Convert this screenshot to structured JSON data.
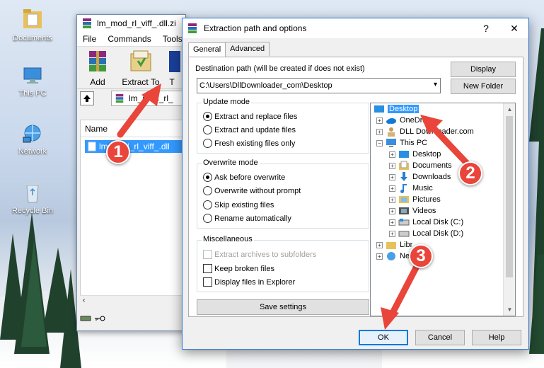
{
  "desktop": {
    "icons": [
      {
        "label": "Documents",
        "icon": "folder-icon"
      },
      {
        "label": "This PC",
        "icon": "computer-icon"
      },
      {
        "label": "Network",
        "icon": "network-icon"
      },
      {
        "label": "Recycle Bin",
        "icon": "recycle-bin-icon"
      }
    ]
  },
  "rar_window": {
    "title": "lm_mod_rl_viff_.dll.zi",
    "menu": [
      "File",
      "Commands",
      "Tools"
    ],
    "toolbar": {
      "add_label": "Add",
      "extract_label": "Extract To",
      "partial_label": "T"
    },
    "path_value": "lm_mod_rl_",
    "list_header": "Name",
    "file_row": "lm_mod_rl_viff_.dll"
  },
  "dialog": {
    "title": "Extraction path and options",
    "help_glyph": "?",
    "close_glyph": "✕",
    "tabs": [
      "General",
      "Advanced"
    ],
    "dest_label": "Destination path (will be created if does not exist)",
    "dest_value": "C:\\Users\\DllDownloader_com\\Desktop",
    "display_button": "Display",
    "new_folder_button": "New Folder",
    "update_mode": {
      "title": "Update mode",
      "options": [
        "Extract and replace files",
        "Extract and update files",
        "Fresh existing files only"
      ],
      "selected": 0
    },
    "overwrite_mode": {
      "title": "Overwrite mode",
      "options": [
        "Ask before overwrite",
        "Overwrite without prompt",
        "Skip existing files",
        "Rename automatically"
      ],
      "selected": 0
    },
    "misc": {
      "title": "Miscellaneous",
      "options": [
        {
          "label": "Extract archives to subfolders",
          "disabled": true
        },
        {
          "label": "Keep broken files",
          "disabled": false
        },
        {
          "label": "Display files in Explorer",
          "disabled": false
        }
      ]
    },
    "save_settings_button": "Save settings",
    "tree": [
      {
        "label": "Desktop",
        "icon": "desktop-icon",
        "selected": true
      },
      {
        "label": "OneDrive",
        "icon": "onedrive-icon"
      },
      {
        "label": "DLL Downloader.com",
        "icon": "user-icon"
      },
      {
        "label": "This PC",
        "icon": "computer-icon"
      },
      {
        "label": "Desktop",
        "icon": "desktop-icon"
      },
      {
        "label": "Documents",
        "icon": "documents-icon"
      },
      {
        "label": "Downloads",
        "icon": "downloads-icon"
      },
      {
        "label": "Music",
        "icon": "music-icon"
      },
      {
        "label": "Pictures",
        "icon": "pictures-icon"
      },
      {
        "label": "Videos",
        "icon": "videos-icon"
      },
      {
        "label": "Local Disk (C:)",
        "icon": "drive-icon"
      },
      {
        "label": "Local Disk (D:)",
        "icon": "drive-icon"
      },
      {
        "label": "Libr",
        "icon": "libraries-icon"
      },
      {
        "label": "Ne",
        "icon": "network-icon"
      }
    ],
    "ok_button": "OK",
    "cancel_button": "Cancel",
    "help_button": "Help"
  },
  "annotations": [
    "1",
    "2",
    "3"
  ],
  "colors": {
    "annotation": "#e9453a",
    "selection": "#3399ff"
  }
}
